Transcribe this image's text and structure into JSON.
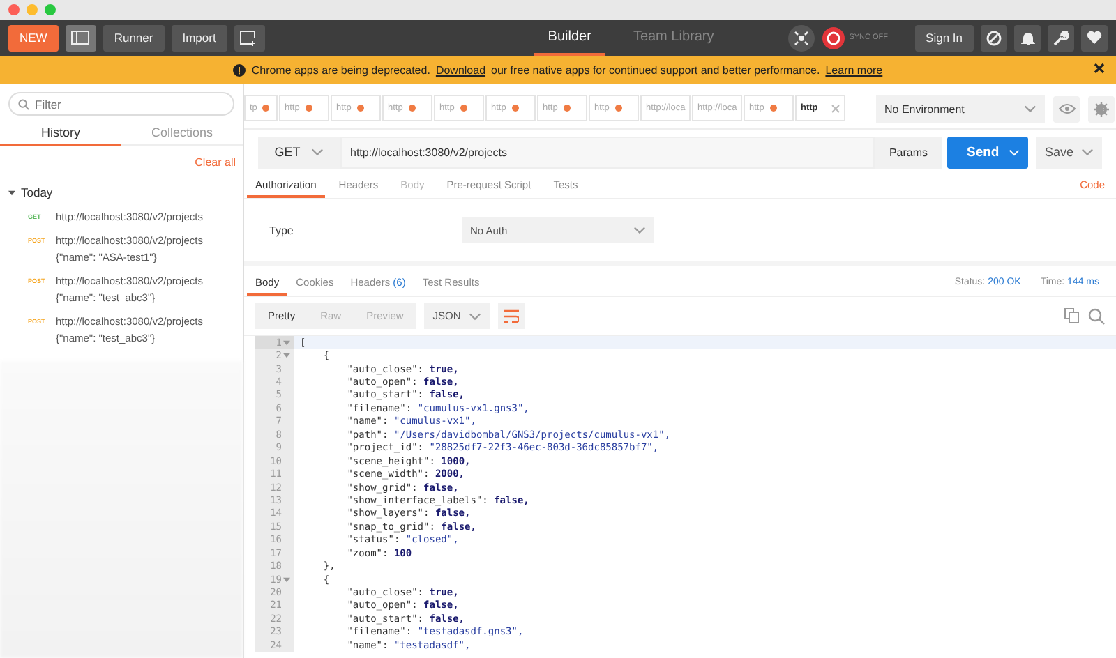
{
  "toolbar": {
    "new_button": "NEW",
    "runner_button": "Runner",
    "import_button": "Import",
    "views": [
      {
        "label": "Builder",
        "selected": true
      },
      {
        "label": "Team Library",
        "selected": false
      }
    ],
    "sync": "SYNC OFF",
    "sign_in": "Sign In"
  },
  "banner": {
    "text_before": "Chrome apps are being deprecated.",
    "link": "Download",
    "text_after": "our free native apps for continued support and better performance.",
    "link2": "Learn more"
  },
  "sidebar": {
    "filter": {
      "placeholder": "Filter"
    },
    "tabs": [
      {
        "label": "History",
        "selected": true
      },
      {
        "label": "Collections",
        "selected": false
      }
    ],
    "clear_all": "Clear all",
    "group": {
      "label": "Today",
      "expanded": true
    },
    "items": [
      {
        "method": "GET",
        "url": "http://localhost:3080/v2/projects"
      },
      {
        "method": "POST",
        "url": "http://localhost:3080/v2/projects",
        "body": "{\"name\": \"ASA-test1\"}"
      },
      {
        "method": "POST",
        "url": "http://localhost:3080/v2/projects",
        "body": "{\"name\": \"test_abc3\"}"
      },
      {
        "method": "POST",
        "url": "http://localhost:3080/v2/projects",
        "body": "{\"name\": \"test_abc3\"}"
      }
    ]
  },
  "request_tabs": [
    {
      "label": "tp",
      "unsaved": true,
      "selected": false
    },
    {
      "label": "http",
      "unsaved": true,
      "selected": false
    },
    {
      "label": "http",
      "unsaved": true,
      "selected": false
    },
    {
      "label": "http",
      "unsaved": true,
      "selected": false
    },
    {
      "label": "http",
      "unsaved": true,
      "selected": false
    },
    {
      "label": "http",
      "unsaved": true,
      "selected": false
    },
    {
      "label": "http",
      "unsaved": true,
      "selected": false
    },
    {
      "label": "http",
      "unsaved": true,
      "selected": false
    },
    {
      "label": "http://loca",
      "unsaved": false,
      "selected": false
    },
    {
      "label": "http://loca",
      "unsaved": false,
      "selected": false
    },
    {
      "label": "http",
      "unsaved": true,
      "selected": false
    },
    {
      "label": "http",
      "unsaved": false,
      "selected": true
    }
  ],
  "environment": "No Environment",
  "request": {
    "method": "GET",
    "url": "http://localhost:3080/v2/projects",
    "params": "Params",
    "send": "Send",
    "save": "Save"
  },
  "request_subtabs": [
    {
      "label": "Authorization",
      "selected": true,
      "disabled": false
    },
    {
      "label": "Headers",
      "selected": false,
      "disabled": false
    },
    {
      "label": "Body",
      "selected": false,
      "disabled": true
    },
    {
      "label": "Pre-request Script",
      "selected": false,
      "disabled": false
    },
    {
      "label": "Tests",
      "selected": false,
      "disabled": false
    }
  ],
  "code_link": "Code",
  "auth": {
    "label": "Type",
    "value": "No Auth"
  },
  "response_tabs": [
    {
      "label": "Body",
      "selected": true
    },
    {
      "label": "Cookies",
      "selected": false
    },
    {
      "label": "Headers",
      "count": "(6)",
      "selected": false
    },
    {
      "label": "Test Results",
      "selected": false
    }
  ],
  "status": {
    "label": "Status:",
    "value": "200 OK",
    "time_label": "Time:",
    "time_value": "144 ms"
  },
  "view_modes": [
    {
      "label": "Pretty",
      "selected": true
    },
    {
      "label": "Raw",
      "selected": false
    },
    {
      "label": "Preview",
      "selected": false
    }
  ],
  "format": "JSON",
  "code_lines": [
    {
      "number": "1",
      "text": "[",
      "foldable": true,
      "selected": true
    },
    {
      "number": "2",
      "text": "    {",
      "foldable": true,
      "selected": false
    },
    {
      "number": "3",
      "text": "        \"auto_close\": true,",
      "foldable": false,
      "selected": false
    },
    {
      "number": "4",
      "text": "        \"auto_open\": false,",
      "foldable": false,
      "selected": false
    },
    {
      "number": "5",
      "text": "        \"auto_start\": false,",
      "foldable": false,
      "selected": false
    },
    {
      "number": "6",
      "text": "        \"filename\": \"cumulus-vx1.gns3\",",
      "foldable": false,
      "selected": false
    },
    {
      "number": "7",
      "text": "        \"name\": \"cumulus-vx1\",",
      "foldable": false,
      "selected": false
    },
    {
      "number": "8",
      "text": "        \"path\": \"/Users/davidbombal/GNS3/projects/cumulus-vx1\",",
      "foldable": false,
      "selected": false
    },
    {
      "number": "9",
      "text": "        \"project_id\": \"28825df7-22f3-46ec-803d-36dc85857bf7\",",
      "foldable": false,
      "selected": false
    },
    {
      "number": "10",
      "text": "        \"scene_height\": 1000,",
      "foldable": false,
      "selected": false
    },
    {
      "number": "11",
      "text": "        \"scene_width\": 2000,",
      "foldable": false,
      "selected": false
    },
    {
      "number": "12",
      "text": "        \"show_grid\": false,",
      "foldable": false,
      "selected": false
    },
    {
      "number": "13",
      "text": "        \"show_interface_labels\": false,",
      "foldable": false,
      "selected": false
    },
    {
      "number": "14",
      "text": "        \"show_layers\": false,",
      "foldable": false,
      "selected": false
    },
    {
      "number": "15",
      "text": "        \"snap_to_grid\": false,",
      "foldable": false,
      "selected": false
    },
    {
      "number": "16",
      "text": "        \"status\": \"closed\",",
      "foldable": false,
      "selected": false
    },
    {
      "number": "17",
      "text": "        \"zoom\": 100",
      "foldable": false,
      "selected": false
    },
    {
      "number": "18",
      "text": "    },",
      "foldable": false,
      "selected": false
    },
    {
      "number": "19",
      "text": "    {",
      "foldable": true,
      "selected": false
    },
    {
      "number": "20",
      "text": "        \"auto_close\": true,",
      "foldable": false,
      "selected": false
    },
    {
      "number": "21",
      "text": "        \"auto_open\": false,",
      "foldable": false,
      "selected": false
    },
    {
      "number": "22",
      "text": "        \"auto_start\": false,",
      "foldable": false,
      "selected": false
    },
    {
      "number": "23",
      "text": "        \"filename\": \"testadasdf.gns3\",",
      "foldable": false,
      "selected": false
    },
    {
      "number": "24",
      "text": "        \"name\": \"testadasdf\",",
      "foldable": false,
      "selected": false
    }
  ]
}
